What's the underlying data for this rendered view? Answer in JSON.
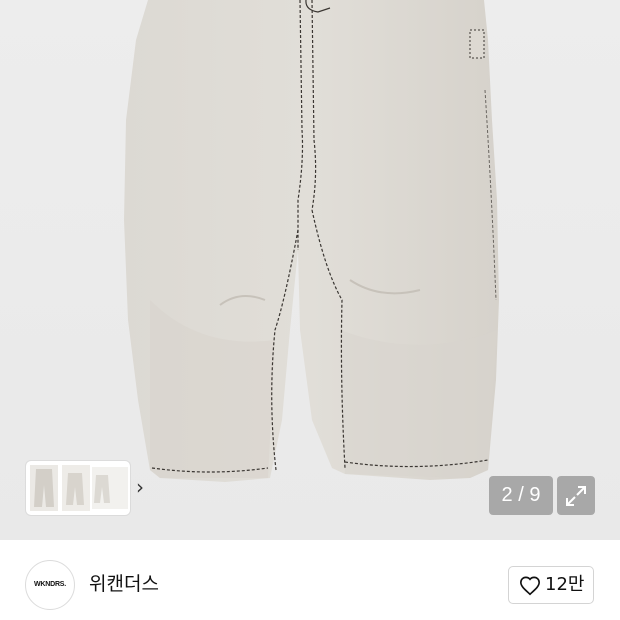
{
  "gallery": {
    "photo_alt": "product-photo",
    "counter_text": "2 / 9",
    "thumb_next_glyph": "›",
    "expand_icon": "expand-icon"
  },
  "brand": {
    "logo_text": "WKNDRS.",
    "name": "위캔더스"
  },
  "like": {
    "icon": "heart-icon",
    "count": "12만"
  }
}
